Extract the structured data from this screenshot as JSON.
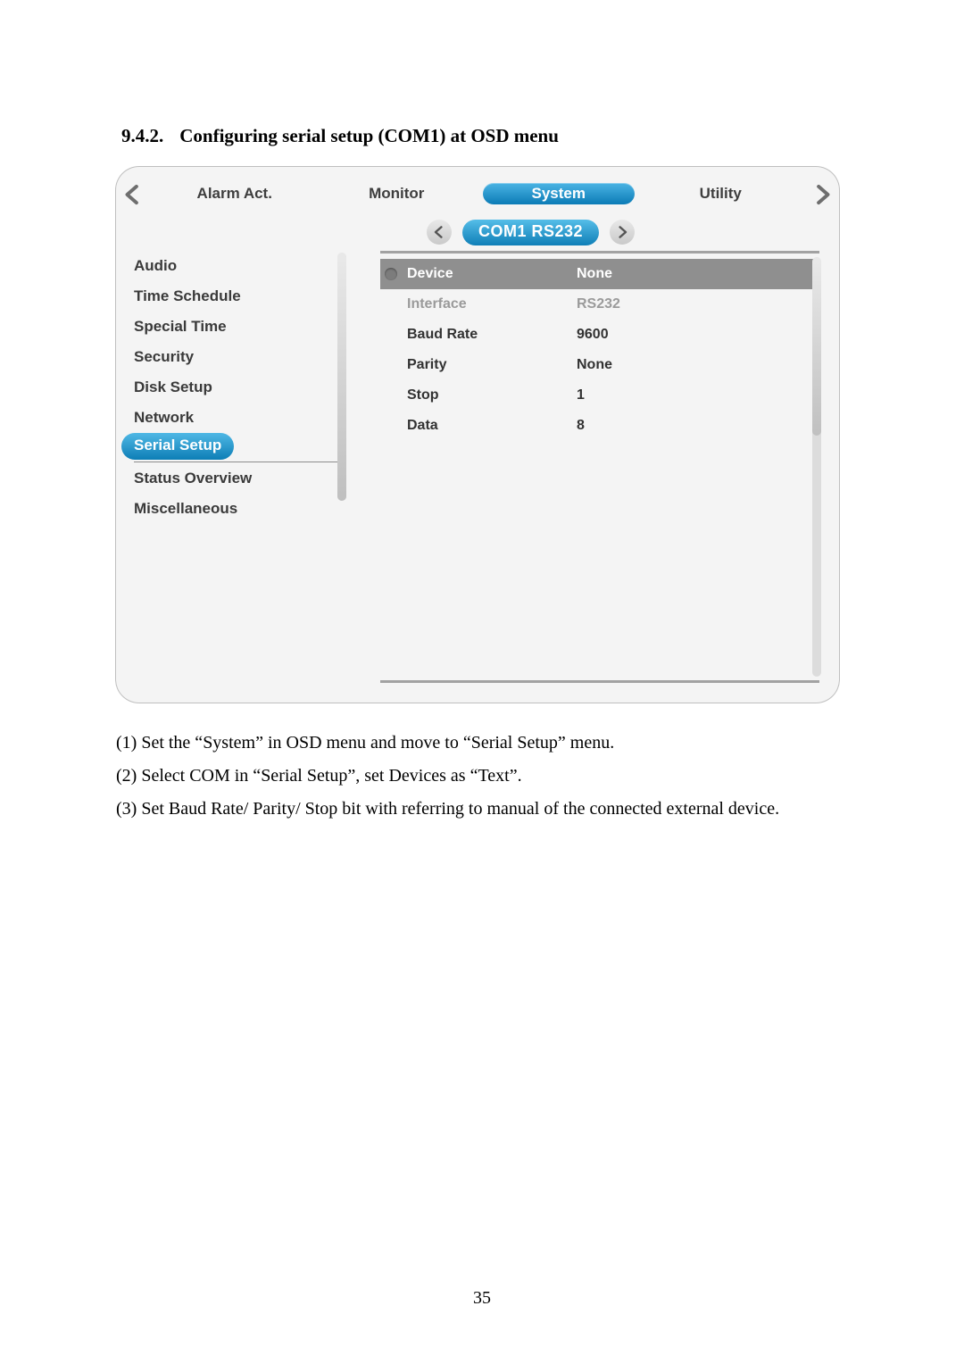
{
  "section": {
    "number": "9.4.2.",
    "title": "Configuring serial setup (COM1) at OSD menu"
  },
  "tabs": {
    "items": [
      "Alarm Act.",
      "Monitor",
      "System",
      "Utility"
    ],
    "activeIndex": 2
  },
  "subtab": {
    "label": "COM1 RS232"
  },
  "sidebar": {
    "items": [
      {
        "label": "Audio",
        "selected": false
      },
      {
        "label": "Time Schedule",
        "selected": false
      },
      {
        "label": "Special Time",
        "selected": false
      },
      {
        "label": "Security",
        "selected": false
      },
      {
        "label": "Disk Setup",
        "selected": false
      },
      {
        "label": "Network",
        "selected": false
      },
      {
        "label": "Serial Setup",
        "selected": true
      },
      {
        "label": "Status Overview",
        "selected": false
      },
      {
        "label": "Miscellaneous",
        "selected": false
      }
    ]
  },
  "params": [
    {
      "label": "Device",
      "value": "None",
      "highlight": true,
      "disabled": false,
      "bullet": true
    },
    {
      "label": "Interface",
      "value": "RS232",
      "highlight": false,
      "disabled": true,
      "bullet": false
    },
    {
      "label": "Baud Rate",
      "value": "9600",
      "highlight": false,
      "disabled": false,
      "bullet": false
    },
    {
      "label": "Parity",
      "value": "None",
      "highlight": false,
      "disabled": false,
      "bullet": false
    },
    {
      "label": "Stop",
      "value": "1",
      "highlight": false,
      "disabled": false,
      "bullet": false
    },
    {
      "label": "Data",
      "value": "8",
      "highlight": false,
      "disabled": false,
      "bullet": false
    }
  ],
  "instructions": [
    "(1)  Set the “System” in OSD menu and move to “Serial Setup” menu.",
    "(2)  Select COM in “Serial Setup”, set Devices as “Text”.",
    "(3)  Set Baud Rate/ Parity/ Stop bit with referring to manual of the connected external device."
  ],
  "pageNumber": "35"
}
